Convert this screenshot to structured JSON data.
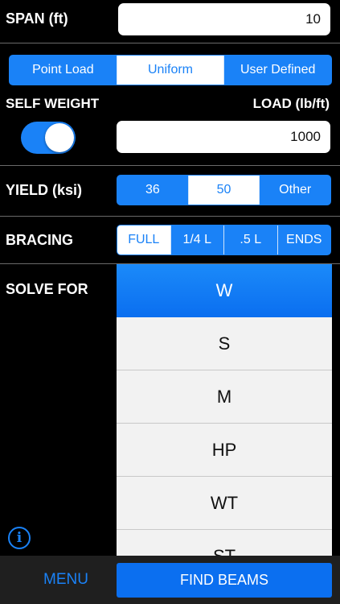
{
  "span": {
    "label": "SPAN (ft)",
    "value": "10"
  },
  "load_type": {
    "options": [
      "Point Load",
      "Uniform",
      "User Defined"
    ],
    "selected": "Uniform"
  },
  "self_weight": {
    "label": "SELF WEIGHT",
    "enabled": true
  },
  "load": {
    "label": "LOAD (lb/ft)",
    "value": "1000"
  },
  "yield": {
    "label": "YIELD (ksi)",
    "options": [
      "36",
      "50",
      "Other"
    ],
    "selected": "50"
  },
  "bracing": {
    "label": "BRACING",
    "options": [
      "FULL",
      "1/4 L",
      ".5 L",
      "ENDS"
    ],
    "selected": "FULL"
  },
  "solve_for": {
    "label": "SOLVE FOR",
    "options": [
      "W",
      "S",
      "M",
      "HP",
      "WT",
      "ST"
    ],
    "selected": "W"
  },
  "footer": {
    "menu_label": "MENU",
    "find_label": "FIND BEAMS",
    "info_glyph": "i"
  },
  "colors": {
    "accent": "#1a82f7",
    "background": "#000000",
    "footer": "#1f1f1f"
  }
}
